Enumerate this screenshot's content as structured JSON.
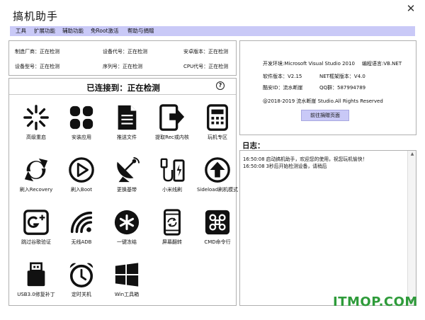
{
  "window": {
    "title": "搞机助手",
    "close_glyph": "✕"
  },
  "menu": [
    "工具",
    "扩展功能",
    "辅助功能",
    "免Root激活",
    "帮助与捐赠"
  ],
  "device_info": [
    {
      "label": "制造厂商：正在检测"
    },
    {
      "label": "设备代号：正在检测"
    },
    {
      "label": "安卓版本：正在检测"
    },
    {
      "label": "设备型号：正在检测"
    },
    {
      "label": "序列号：正在检测"
    },
    {
      "label": "CPU代号：正在检测"
    }
  ],
  "connection": {
    "title": "已连接到：正在检测",
    "help_glyph": "?"
  },
  "tools": [
    {
      "label": "高级重启",
      "icon": "burst-icon"
    },
    {
      "label": "安装应用",
      "icon": "apps-grid-icon"
    },
    {
      "label": "推送文件",
      "icon": "document-icon"
    },
    {
      "label": "提取Rec或内核",
      "icon": "tablet-export-icon"
    },
    {
      "label": "玩机专区",
      "icon": "calculator-icon"
    },
    {
      "label": "刷入Recovery",
      "icon": "recycle-arrows-icon"
    },
    {
      "label": "刷入Boot",
      "icon": "play-circle-icon"
    },
    {
      "label": "更换基带",
      "icon": "satellite-dish-icon"
    },
    {
      "label": "小米线刷",
      "icon": "usb-phone-icon"
    },
    {
      "label": "Sideload刷机模式",
      "icon": "upload-circle-icon"
    },
    {
      "label": "跳过谷歌验证",
      "icon": "google-plus-icon"
    },
    {
      "label": "无线ADB",
      "icon": "wifi-icon"
    },
    {
      "label": "一键冻结",
      "icon": "snowflake-icon"
    },
    {
      "label": "屏幕翻转",
      "icon": "rotate-phone-icon"
    },
    {
      "label": "CMD命令行",
      "icon": "command-key-icon"
    },
    {
      "label": "USB3.0修复补丁",
      "icon": "usb-drive-icon"
    },
    {
      "label": "定时关机",
      "icon": "alarm-clock-icon"
    },
    {
      "label": "Win工具箱",
      "icon": "windows-icon"
    }
  ],
  "about": {
    "dev_env": "开发环境:Microsoft Visual Studio 2010",
    "language": "编程语言:VB.NET",
    "version": "软件版本：V2.15",
    "framework": "NET框架版本：V4.0",
    "author": "酷安ID：流水断崖",
    "qq": "QQ群：587994789",
    "copyright": "@2018-2019  流水断崖 Studio.All Rights Reserved",
    "button": "前往捐赠页面"
  },
  "log": {
    "title": "日志：",
    "lines": [
      "16:50:08 启动搞机助手，欢迎您的使用，祝您玩机愉快！",
      "16:50:08 3秒后开始检测设备，请稍后"
    ],
    "scroll_up": "▲",
    "scroll_down": "▼"
  },
  "watermark": "ITMOP.COM",
  "colors": {
    "menu_bg": "#c9c9f7",
    "watermark": "#2e9b3a",
    "icon": "#111111"
  }
}
